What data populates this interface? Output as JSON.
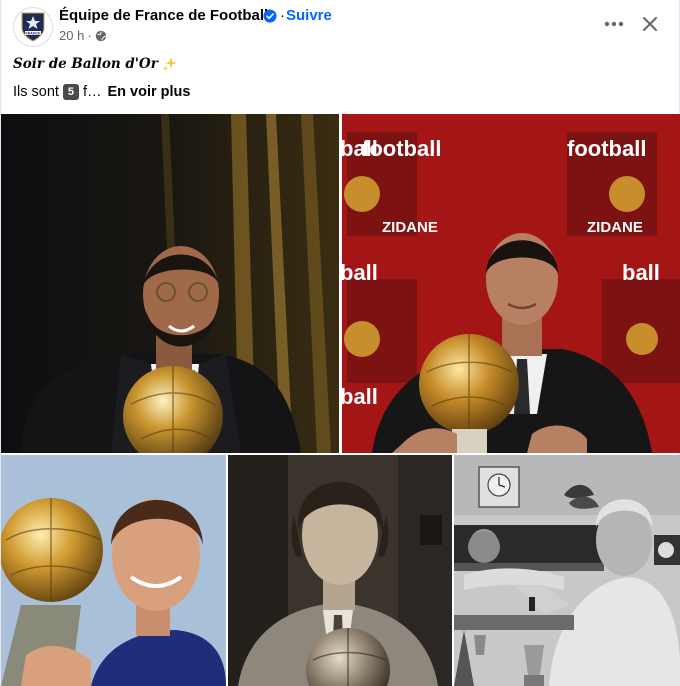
{
  "post": {
    "page_name": "Équipe de France de Football",
    "follow_label": "Suivre",
    "time": "20 h",
    "dot": "·",
    "title": "Soir de Ballon d'Or",
    "body_prefix": "Ils sont",
    "body_number": "5",
    "body_suffix": "f…",
    "see_more": "En voir plus"
  },
  "avatar": {
    "logo_text": "FRANCE"
  },
  "photo2": {
    "wall_text": "football",
    "wall_text_short": "ball",
    "name_text": "ZIDANE"
  },
  "colors": {
    "brand_blue": "#0866ff",
    "secondary_text": "#65676b",
    "primary_text": "#050505",
    "gold": "#c99a3b"
  },
  "icons": {
    "verified": "verified-badge-icon",
    "globe": "globe-icon",
    "more": "more-options-icon",
    "close": "close-icon",
    "sparkle": "sparkles-icon"
  }
}
